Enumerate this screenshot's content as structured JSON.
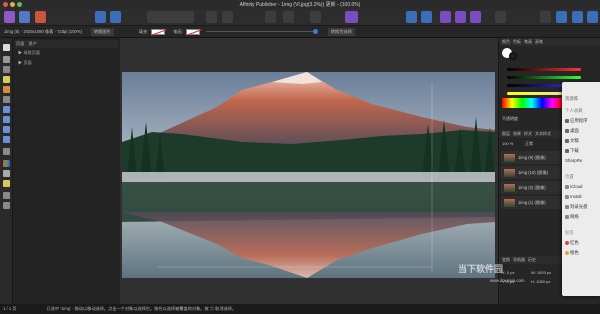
{
  "window": {
    "title": "Affinity Publisher - 1img (VI.jpg(3.2%)) 更新 - (100.0%)"
  },
  "context_bar": {
    "doc_info": "1img (8) · 1920x1080 像素 · 72dpi (100%)",
    "fill_label": "填充:",
    "stroke_label": "笔画:",
    "action": "转换为选择",
    "extra": "转换图片"
  },
  "left_panel": {
    "tabs": [
      "页面",
      "资产"
    ],
    "rows": [
      "▶ 母版页面",
      "▶ 页面"
    ]
  },
  "right_panel": {
    "tabs": [
      "颜色",
      "色板",
      "笔画",
      "画笔"
    ],
    "opacity_label": "不透明度",
    "layers_tabs": [
      "图层",
      "效果",
      "样式",
      "文本样式"
    ],
    "blend": "正常",
    "opacity_value": "100 %",
    "layers": [
      {
        "name": "1img (9)",
        "kind": "(图像)"
      },
      {
        "name": "1img (10)",
        "kind": "(图像)"
      },
      {
        "name": "1img (2)",
        "kind": "(图像)"
      },
      {
        "name": "1img (1)",
        "kind": "(图像)"
      }
    ],
    "transform_tabs": [
      "变换",
      "导航器",
      "历史"
    ],
    "x": "X: 0 px",
    "y": "Y: 0 px",
    "w": "W: 1920 px",
    "h": "H: 1080 px"
  },
  "popup": {
    "items": [
      "资源库",
      "个人收藏",
      "应用程序",
      "桌面",
      "文稿",
      "下载",
      "SharpRe",
      "位置",
      "iCloud",
      "Install",
      "刻录光盘",
      "网络",
      "标签",
      "红色",
      "橙色"
    ]
  },
  "status_bar": {
    "page": "1 / 1 页",
    "text": "已选中 '1img' · 拖动以移动选择。点击一个对象以选择它。按住以选择被覆盖的对象。按 ⌘ 取消选择。"
  },
  "watermark": {
    "brand": "当下软件园",
    "url": "www.downxia.com"
  },
  "colors": {
    "accent": "#3f79d6",
    "bg": "#1e1e1e",
    "panel": "#262626"
  }
}
